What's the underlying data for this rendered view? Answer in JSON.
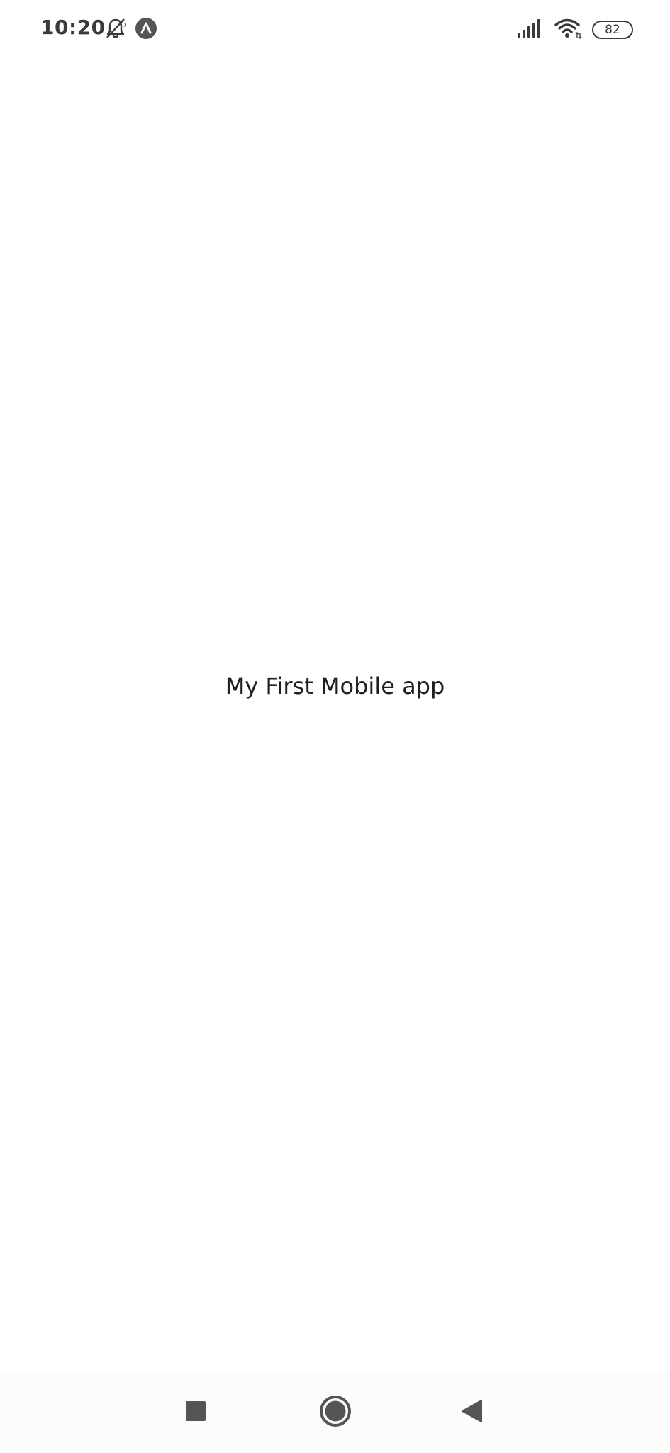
{
  "status_bar": {
    "time": "10:20",
    "battery_level": "82",
    "icons": [
      "bell-off-icon",
      "app-notification-icon",
      "signal-icon",
      "wifi-icon",
      "battery-icon"
    ]
  },
  "main": {
    "title": "My First Mobile app"
  },
  "nav_bar": {
    "buttons": [
      "recents-button",
      "home-button",
      "back-button"
    ]
  },
  "colors": {
    "background": "#ffffff",
    "status_icons": "#3a3a3a",
    "nav_icons": "#555555",
    "text": "#1f1f1f"
  }
}
